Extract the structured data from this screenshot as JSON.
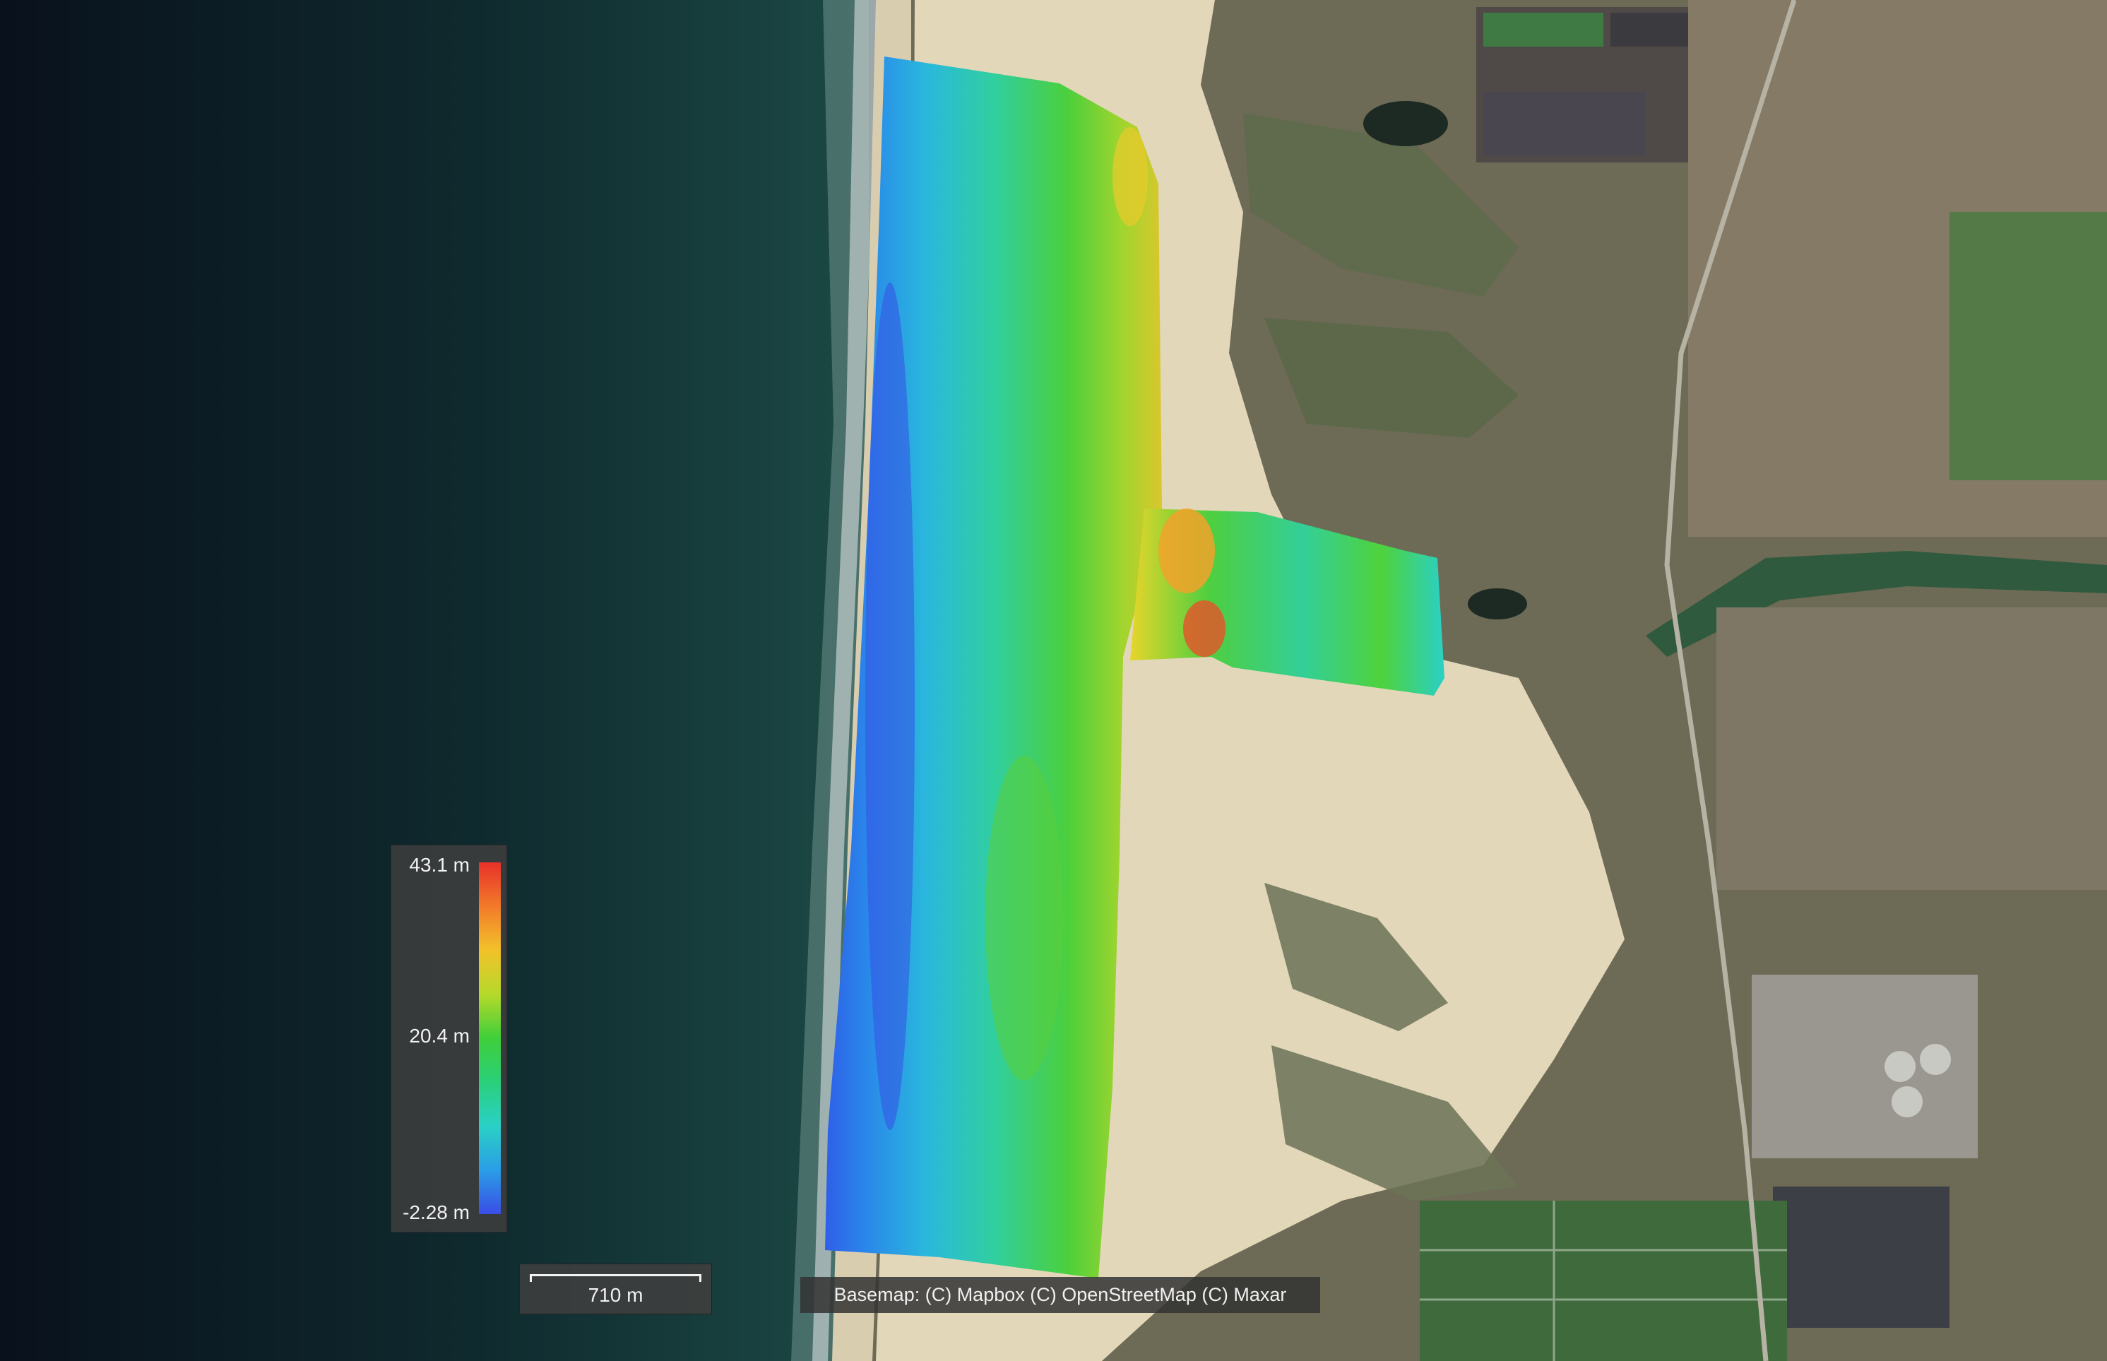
{
  "legend": {
    "max_label": "43.1 m",
    "mid_label": "20.4 m",
    "min_label": "-2.28 m",
    "ramp_colors": [
      "#e8312a",
      "#f27a2a",
      "#f2c22a",
      "#b6d92a",
      "#3fcf3a",
      "#2ad07a",
      "#2ad0c6",
      "#2a9ee6",
      "#3a4de6"
    ]
  },
  "scale": {
    "label": "710 m"
  },
  "attribution": {
    "text": "Basemap: (C) Mapbox (C) OpenStreetMap (C) Maxar"
  },
  "colors": {
    "ocean_deep": "#0b1420",
    "ocean_near": "#163d3a",
    "surf": "#e6eaea",
    "beach": "#d9cdb0",
    "sand_dunes": "#e3d7ba",
    "vegetation": "#566a4a",
    "town": "#8a7f6e"
  }
}
